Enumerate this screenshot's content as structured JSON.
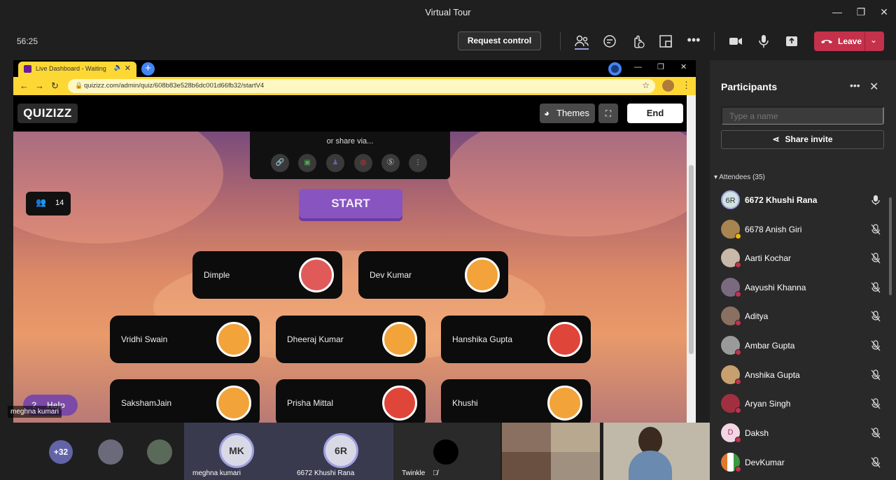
{
  "window": {
    "title": "Virtual Tour"
  },
  "toolbar": {
    "timer": "56:25",
    "request_control": "Request control",
    "leave": "Leave"
  },
  "browser": {
    "tab_title": "Live Dashboard - Waiting",
    "url": "quizizz.com/admin/quiz/608b83e528b6dc001d66fb32/startV4"
  },
  "quiz": {
    "logo": "QUIZIZZ",
    "themes": "Themes",
    "end": "End",
    "share_label": "or share via...",
    "player_count": "14",
    "start": "START",
    "help": "Help",
    "players": [
      {
        "name": "Dimple",
        "color": "#e05a5a"
      },
      {
        "name": "Dev Kumar",
        "color": "#f2a33a"
      },
      {
        "name": "Vridhi Swain",
        "color": "#f2a33a"
      },
      {
        "name": "Dheeraj Kumar",
        "color": "#f2a33a"
      },
      {
        "name": "Hanshika Gupta",
        "color": "#e0453a"
      },
      {
        "name": "SakshamJain",
        "color": "#f2a33a"
      },
      {
        "name": "Prisha Mittal",
        "color": "#e0453a"
      },
      {
        "name": "Khushi",
        "color": "#f2a33a"
      }
    ]
  },
  "presenter": {
    "name": "meghna kumari"
  },
  "participants": {
    "title": "Participants",
    "search_placeholder": "Type a name",
    "share_invite": "Share invite",
    "attendees_label": "Attendees (35)",
    "list": [
      {
        "name": "6672 Khushi Rana",
        "initials": "6R",
        "muted": false,
        "bold": true
      },
      {
        "name": "6678 Anish Giri",
        "initials": "",
        "muted": true,
        "bold": false
      },
      {
        "name": "Aarti Kochar",
        "initials": "",
        "muted": true,
        "bold": false
      },
      {
        "name": "Aayushi Khanna",
        "initials": "",
        "muted": true,
        "bold": false
      },
      {
        "name": "Aditya",
        "initials": "",
        "muted": true,
        "bold": false
      },
      {
        "name": "Ambar Gupta",
        "initials": "",
        "muted": true,
        "bold": false
      },
      {
        "name": "Anshika Gupta",
        "initials": "",
        "muted": true,
        "bold": false
      },
      {
        "name": "Aryan Singh",
        "initials": "",
        "muted": true,
        "bold": false
      },
      {
        "name": "Daksh",
        "initials": "D",
        "muted": true,
        "bold": false
      },
      {
        "name": "DevKumar",
        "initials": "",
        "muted": true,
        "bold": false
      }
    ]
  },
  "strip": {
    "overflow": "+32",
    "tiles": [
      {
        "initials": "MK",
        "name": "meghna kumari"
      },
      {
        "initials": "6R",
        "name": "6672 Khushi Rana"
      }
    ],
    "twinkle": "Twinkle"
  }
}
